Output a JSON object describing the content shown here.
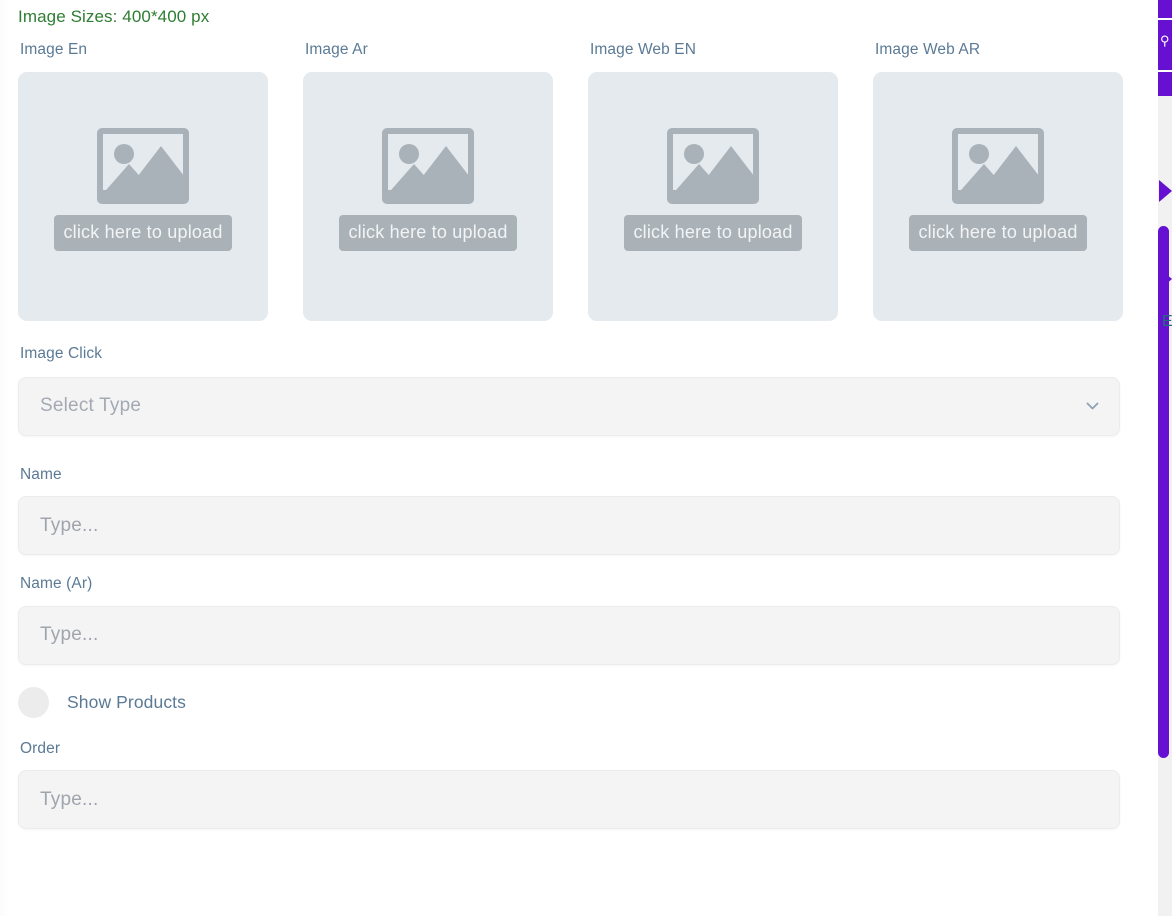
{
  "form": {
    "size_note": "Image Sizes: 400*400 px",
    "uploads": [
      {
        "label": "Image En",
        "cta": "click here to upload",
        "icon": "image-placeholder-icon"
      },
      {
        "label": "Image Ar",
        "cta": "click here to upload",
        "icon": "image-placeholder-icon"
      },
      {
        "label": "Image Web EN",
        "cta": "click here to upload",
        "icon": "image-placeholder-icon"
      },
      {
        "label": "Image Web AR",
        "cta": "click here to upload",
        "icon": "image-placeholder-icon"
      }
    ],
    "image_click": {
      "label": "Image Click",
      "value": "",
      "placeholder": "Select Type",
      "chevron_icon": "chevron-down-icon"
    },
    "name": {
      "label": "Name",
      "value": "",
      "placeholder": "Type..."
    },
    "name_ar": {
      "label": "Name (Ar)",
      "value": "",
      "placeholder": "Type..."
    },
    "show_products": {
      "label": "Show Products",
      "checked": false
    },
    "order": {
      "label": "Order",
      "value": "",
      "placeholder": "Type..."
    }
  },
  "right_rail": {
    "accent_color": "#6610d2",
    "search_icon": "search-icon",
    "cut_label": "E",
    "scrollbar": {
      "orientation": "vertical"
    }
  },
  "colors": {
    "note_green": "#2e7d32",
    "label_blue": "#5b7a95",
    "field_bg": "#f4f4f4",
    "upload_bg": "#e5eaee",
    "purple": "#6610d2"
  }
}
